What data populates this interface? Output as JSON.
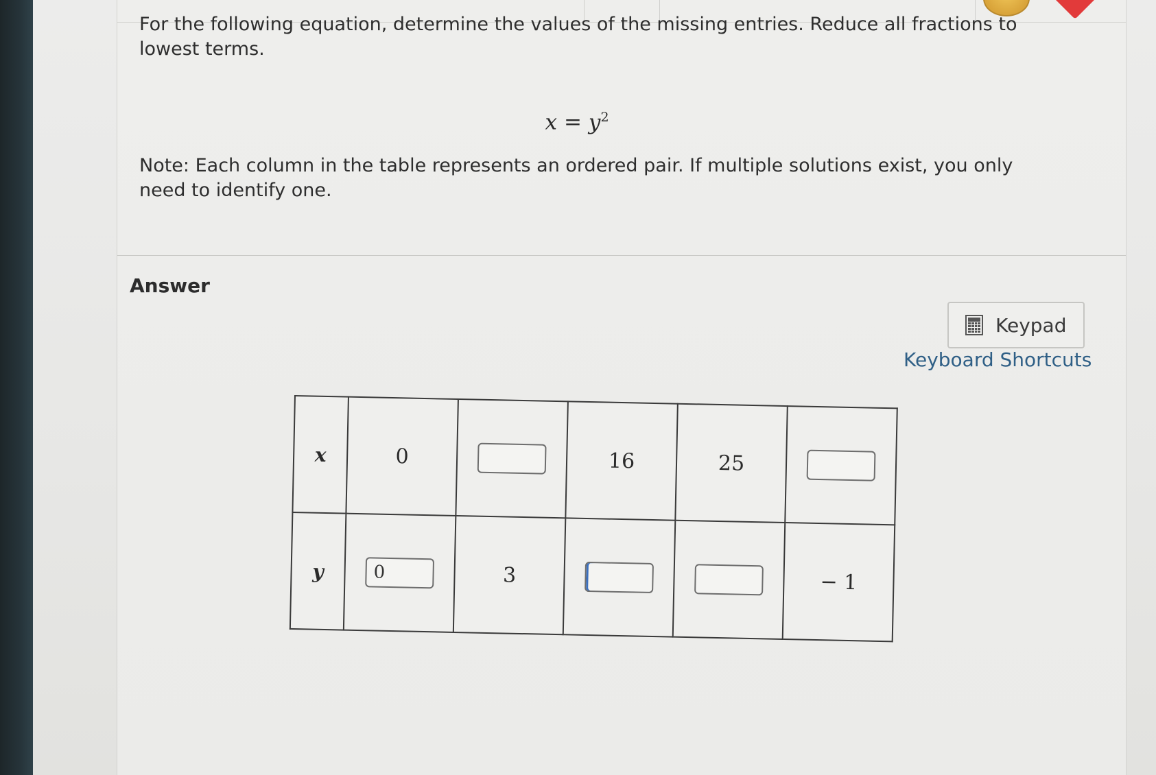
{
  "question": {
    "instruction": "For the following equation, determine the values of the missing entries. Reduce all fractions to lowest terms.",
    "equation": {
      "left": "x",
      "operator": "=",
      "base": "y",
      "exponent": "2"
    },
    "note": "Note: Each column in the table represents an ordered pair. If multiple solutions exist, you only need to identify one."
  },
  "answer": {
    "heading": "Answer",
    "keypad_label": "Keypad",
    "shortcuts_label": "Keyboard Shortcuts",
    "icons": {
      "keypad": "calculator-icon"
    }
  },
  "table": {
    "x_label": "x",
    "y_label": "y",
    "columns": [
      {
        "x": "0",
        "y": "0"
      },
      {
        "x": "",
        "y": "3"
      },
      {
        "x": "16",
        "y": ""
      },
      {
        "x": "25",
        "y": ""
      },
      {
        "x": "",
        "y": "− 1"
      }
    ]
  }
}
